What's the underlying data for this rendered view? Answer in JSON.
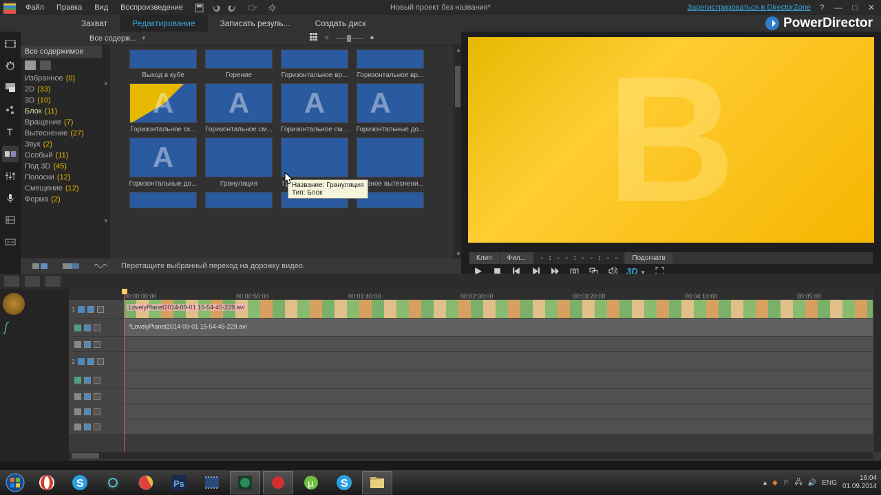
{
  "menu": {
    "file": "Файл",
    "edit": "Правка",
    "view": "Вид",
    "play": "Воспроизведение"
  },
  "project_title": "Новый проект без названия*",
  "register_link": "Зарегистрироваться в DirectorZone",
  "brand": "PowerDirector",
  "tabs": {
    "capture": "Захват",
    "edit": "Редактирование",
    "produce": "Записать резуль...",
    "disc": "Создать диск"
  },
  "browser": {
    "filter": "Все содерж...",
    "side_header": "Все содержимое",
    "categories": [
      {
        "name": "Избранное",
        "count": "(0)"
      },
      {
        "name": "2D",
        "count": "(33)"
      },
      {
        "name": "3D",
        "count": "(10)"
      },
      {
        "name": "Блок",
        "count": "(11)",
        "sel": true
      },
      {
        "name": "Вращение",
        "count": "(7)"
      },
      {
        "name": "Вытеснение",
        "count": "(27)"
      },
      {
        "name": "Звук",
        "count": "(2)"
      },
      {
        "name": "Особый",
        "count": "(11)"
      },
      {
        "name": "Под 3D",
        "count": "(45)"
      },
      {
        "name": "Полоски",
        "count": "(12)"
      },
      {
        "name": "Смещение",
        "count": "(12)"
      },
      {
        "name": "Форма",
        "count": "(2)"
      }
    ],
    "thumbs": [
      {
        "label": "Выход в кубе"
      },
      {
        "label": "Горение"
      },
      {
        "label": "Горизонтальное вр..."
      },
      {
        "label": "Горизонтальное вр..."
      },
      {
        "label": "Горизонтальное ск..."
      },
      {
        "label": "Горизонтальное см..."
      },
      {
        "label": "Горизонтальное см..."
      },
      {
        "label": "Горизонтальные до..."
      },
      {
        "label": "Горизонтальные до..."
      },
      {
        "label": "Грануляция"
      },
      {
        "label": "Грубое растворение"
      },
      {
        "label": "Грязное вытеснени..."
      }
    ],
    "hint": "Перетащите выбранный переход на дорожку видео."
  },
  "tooltip": {
    "l1": "Название: Грануляция",
    "l2": "Тип: Блок"
  },
  "preview": {
    "letter": "B",
    "seg_clip": "Клип",
    "seg_film": "Фил...",
    "tc": "- : - - : - - : - -",
    "fit": "Подогнатв",
    "td": "3D"
  },
  "timeline": {
    "ticks": [
      "00:00:00:00",
      "00:00:50:00",
      "00:01:40:00",
      "00:02:30:00",
      "00:03:20:00",
      "00:04:10:00",
      "00:05:00"
    ],
    "clip_video": "LovelyPlanet2014-09-01 15-54-45-229.avi",
    "clip_audio": "*LovelyPlanet2014-09-01 15-54-45-229.avi"
  },
  "taskbar": {
    "lang": "ENG",
    "time": "16:04",
    "date": "01.09.2014"
  }
}
